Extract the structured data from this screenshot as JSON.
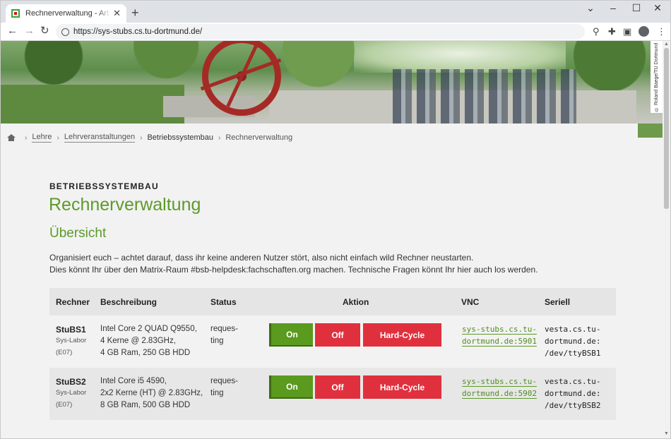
{
  "browser": {
    "tab_title": "Rechnerverwaltung - Arbeitsgruppe",
    "url": "https://sys-stubs.cs.tu-dortmund.de/"
  },
  "hero": {
    "credit": "© Roland Baege/TU Dortmund"
  },
  "breadcrumb": {
    "items": [
      "Lehre",
      "Lehrveranstaltungen",
      "Betriebssystembau",
      "Rechnerverwaltung"
    ]
  },
  "page": {
    "kicker": "BETRIEBSSYSTEMBAU",
    "title": "Rechnerverwaltung",
    "subtitle": "Übersicht",
    "intro_1": "Organisiert euch – achtet darauf, dass ihr keine anderen Nutzer stört, also nicht einfach wild Rechner neustarten.",
    "intro_2": "Dies könnt Ihr über den Matrix-Raum #bsb-helpdesk:fachschaften.org machen. Technische Fragen könnt Ihr hier auch los werden."
  },
  "table": {
    "headers": [
      "Rechner",
      "Beschreibung",
      "Status",
      "Aktion",
      "VNC",
      "Seriell"
    ],
    "rows": [
      {
        "name": "StuBS1",
        "lab": "Sys-Labor",
        "room": "(E07)",
        "desc": [
          "Intel Core 2 QUAD Q9550,",
          "4 Kerne @ 2.83GHz,",
          "4 GB Ram, 250 GB HDD"
        ],
        "status": [
          "reques-",
          "ting"
        ],
        "actions": {
          "on": "On",
          "off": "Off",
          "hard": "Hard-Cycle"
        },
        "vnc": [
          "sys-stubs.cs.tu-",
          "dortmund.de:5901"
        ],
        "serial": [
          "vesta.cs.tu-",
          "dortmund.de:",
          "/dev/ttyBSB1"
        ]
      },
      {
        "name": "StuBS2",
        "lab": "Sys-Labor",
        "room": "(E07)",
        "desc": [
          "Intel Core i5 4590,",
          "2x2 Kerne (HT) @ 2.83GHz,",
          "8 GB Ram, 500 GB HDD"
        ],
        "status": [
          "reques-",
          "ting"
        ],
        "actions": {
          "on": "On",
          "off": "Off",
          "hard": "Hard-Cycle"
        },
        "vnc": [
          "sys-stubs.cs.tu-",
          "dortmund.de:5902"
        ],
        "serial": [
          "vesta.cs.tu-",
          "dortmund.de:",
          "/dev/ttyBSB2"
        ]
      }
    ]
  },
  "colors": {
    "accent_green": "#5d9a2a",
    "on_button": "#5a9a1e",
    "off_button": "#e0303e"
  }
}
